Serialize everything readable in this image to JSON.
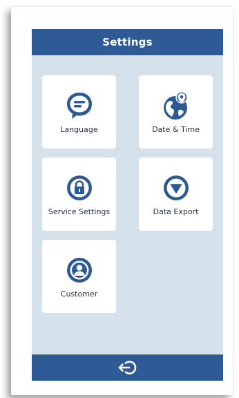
{
  "header": {
    "title": "Settings"
  },
  "tiles": [
    {
      "label": "Language",
      "icon": "speech-bubble-icon"
    },
    {
      "label": "Date & Time",
      "icon": "globe-pin-icon"
    },
    {
      "label": "Service Settings",
      "icon": "lock-icon"
    },
    {
      "label": "Data Export",
      "icon": "download-arrow-icon"
    },
    {
      "label": "Customer",
      "icon": "user-icon"
    }
  ],
  "footer": {
    "back_icon": "back-icon"
  },
  "colors": {
    "accent": "#2e5a96",
    "background": "#d5e2ec",
    "tile": "#ffffff",
    "icon": "#2d5a93"
  }
}
